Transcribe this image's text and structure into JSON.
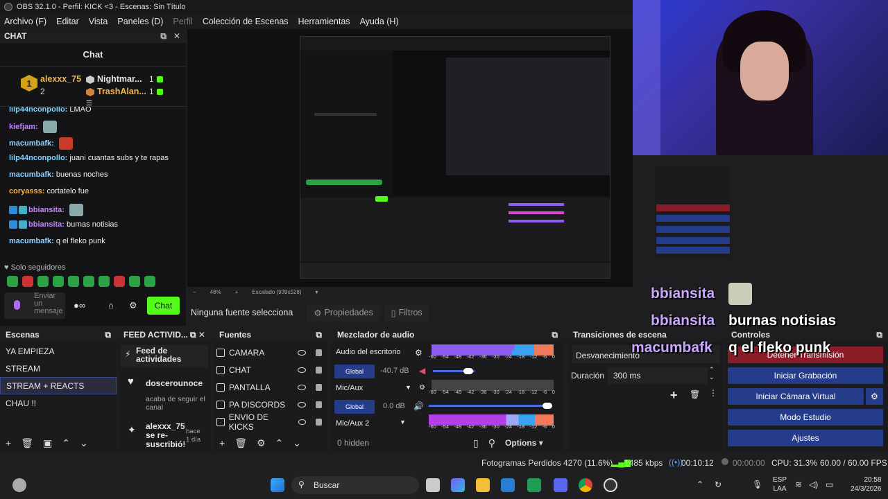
{
  "window": {
    "title": "OBS 32.1.0 - Perfil: KICK <3 - Escenas: Sin Título"
  },
  "menu": [
    "Archivo (F)",
    "Editar",
    "Vista",
    "Paneles (D)",
    "Perfil",
    "Colección de Escenas",
    "Herramientas",
    "Ayuda (H)"
  ],
  "chat_dock": {
    "dock_title": "CHAT",
    "title": "Chat",
    "leader1": {
      "name": "alexxx_75",
      "rank": "1",
      "count": "2"
    },
    "leader2": {
      "name": "Nightmar...",
      "count": "1"
    },
    "leader3": {
      "name": "TrashAlan...",
      "count": "1"
    },
    "messages": [
      {
        "user": "lilp44nconpollo:",
        "text": "LMAO",
        "color": "#7cd3ff"
      },
      {
        "user": "kiefjam:",
        "text": "",
        "color": "#c283ff"
      },
      {
        "user": "macumbafk:",
        "text": "",
        "color": "#8fd4ff"
      },
      {
        "user": "lilp44nconpollo:",
        "text": "juani cuantas subs y te rapas",
        "color": "#7cd3ff"
      },
      {
        "user": "macumbafk:",
        "text": "buenas noches",
        "color": "#8fd4ff"
      },
      {
        "user": "coryasss:",
        "text": "cortatelo fue",
        "color": "#f5b544"
      },
      {
        "user": "bbiansita:",
        "text": "",
        "color": "#c283ff"
      },
      {
        "user": "bbiansita:",
        "text": "burnas notisias",
        "color": "#c283ff"
      },
      {
        "user": "macumbafk:",
        "text": "q el fleko punk",
        "color": "#8fd4ff"
      }
    ],
    "followers_only": "Solo seguidores",
    "input_placeholder": "Enviar un mensaje",
    "send_label": "Chat"
  },
  "overlay": {
    "line1_user": "bbiansita",
    "line2_user": "bbiansita",
    "line2_text": "burnas notisias",
    "line3_user": "macumbafk",
    "line3_text": "q el fleko punk"
  },
  "preview": {
    "zoom": "48%",
    "scaling": "Escalado (939x528)",
    "no_source": "Ninguna fuente selecciona",
    "properties": "Propiedades",
    "filters": "Filtros"
  },
  "scenes": {
    "title": "Escenas",
    "items": [
      "YA EMPIEZA",
      "STREAM",
      "STREAM + REACTS",
      "CHAU !!"
    ],
    "selected_index": 2
  },
  "feed": {
    "title": "FEED ACTIVID...",
    "header": "Feed de actividades",
    "item1_user": "doscerounoce",
    "item1_text": "acaba de seguir el canal",
    "item2_user": "alexxx_75 se re-suscribió!",
    "item2_time": "hace 1 día"
  },
  "sources": {
    "title": "Fuentes",
    "items": [
      "CAMARA",
      "CHAT",
      "PANTALLA",
      "PA DISCORDS",
      "ENVIO DE KICKS"
    ]
  },
  "mixer": {
    "title": "Mezclador de audio",
    "ch1": {
      "name": "Audio del escritorio",
      "db": "-40.7 dB",
      "level": 0.38
    },
    "ch2": {
      "name": "Mic/Aux",
      "db": "0.0 dB",
      "level": 1.0
    },
    "ch3": {
      "name": "Mic/Aux 2"
    },
    "global": "Global",
    "scale": [
      "-60",
      "-54",
      "-48",
      "-42",
      "-36",
      "-30",
      "-24",
      "-18",
      "-12",
      "-6",
      "0"
    ],
    "hidden": "0 hidden",
    "options": "Options"
  },
  "transitions": {
    "title": "Transiciones de escena",
    "type": "Desvanecimiento",
    "duration_label": "Duración",
    "duration": "300 ms"
  },
  "controls": {
    "title": "Controles",
    "buttons": [
      "Detener Transmisión",
      "Iniciar Grabación",
      "Iniciar Cámara Virtual",
      "Modo Estudio",
      "Ajustes"
    ]
  },
  "status": {
    "dropped": "Fotogramas Perdidos 4270 (11.6%)",
    "bitrate": "1485 kbps",
    "stream_time": "00:10:12",
    "rec_time": "00:00:00",
    "cpu": "CPU: 31.3%",
    "fps": "60.00 / 60.00 FPS"
  },
  "taskbar": {
    "search": "Buscar",
    "lang1": "ESP",
    "lang2": "LAA",
    "time": "20:58",
    "date": "24/3/2026"
  },
  "colors": {
    "kick_green": "#53fc18",
    "obs_blue": "#243c8a",
    "overlay_purple": "#c9a6ff"
  }
}
